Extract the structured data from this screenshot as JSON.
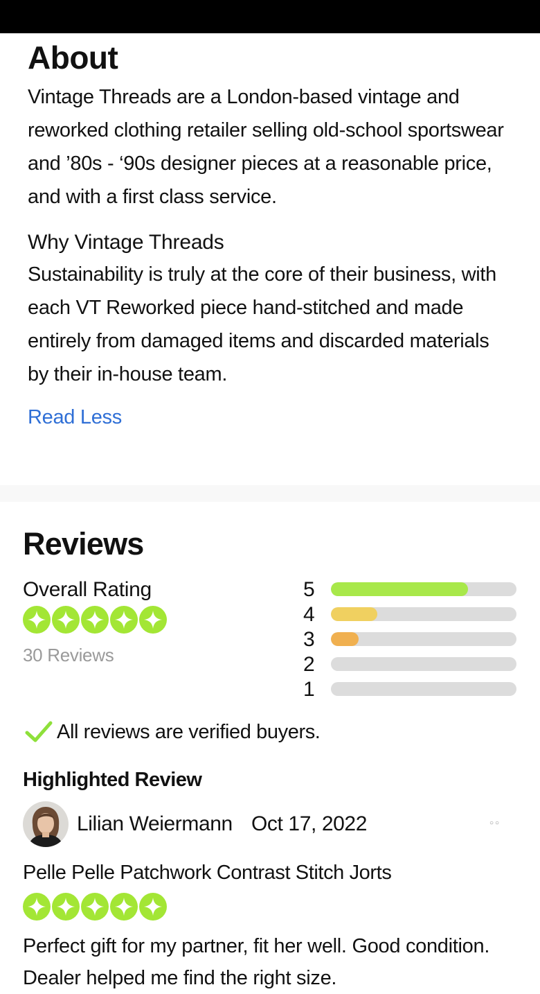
{
  "about": {
    "title": "About",
    "description": "Vintage Threads are a London-based vintage and reworked clothing retailer selling old-school sportswear and ’80s - ‘90s designer pieces at a reasonable price, and with a first class service.",
    "why_title": "Why Vintage Threads",
    "why_text": "Sustainability is truly at the core of their business, with each VT Reworked piece hand-stitched and made entirely from damaged items and discarded materials by their in-house team.",
    "read_less": "Read Less"
  },
  "reviews": {
    "title": "Reviews",
    "overall_label": "Overall Rating",
    "overall_stars": 5,
    "count_text": "30 Reviews",
    "breakdown": [
      {
        "label": "5",
        "fraction": 0.74,
        "color": "#a8e84a"
      },
      {
        "label": "4",
        "fraction": 0.25,
        "color": "#f0d060"
      },
      {
        "label": "3",
        "fraction": 0.15,
        "color": "#f0b050"
      },
      {
        "label": "2",
        "fraction": 0,
        "color": "#dcdcdc"
      },
      {
        "label": "1",
        "fraction": 0,
        "color": "#dcdcdc"
      }
    ],
    "verified_text": "All reviews are verified buyers.",
    "highlighted_label": "Highlighted Review",
    "highlighted": {
      "reviewer": "Lilian Weiermann",
      "date": "Oct 17, 2022",
      "product": "Pelle Pelle Patchwork Contrast Stitch Jorts",
      "stars": 5,
      "body": "Perfect gift for my partner, fit her well. Good condition. Dealer helped me find the right size."
    }
  },
  "colors": {
    "accent_link": "#2f6fd6",
    "star_green": "#a3e635",
    "check_green": "#8ee03a"
  },
  "icons": {
    "star": "star-icon",
    "check": "check-icon",
    "more": "more-options-icon"
  }
}
